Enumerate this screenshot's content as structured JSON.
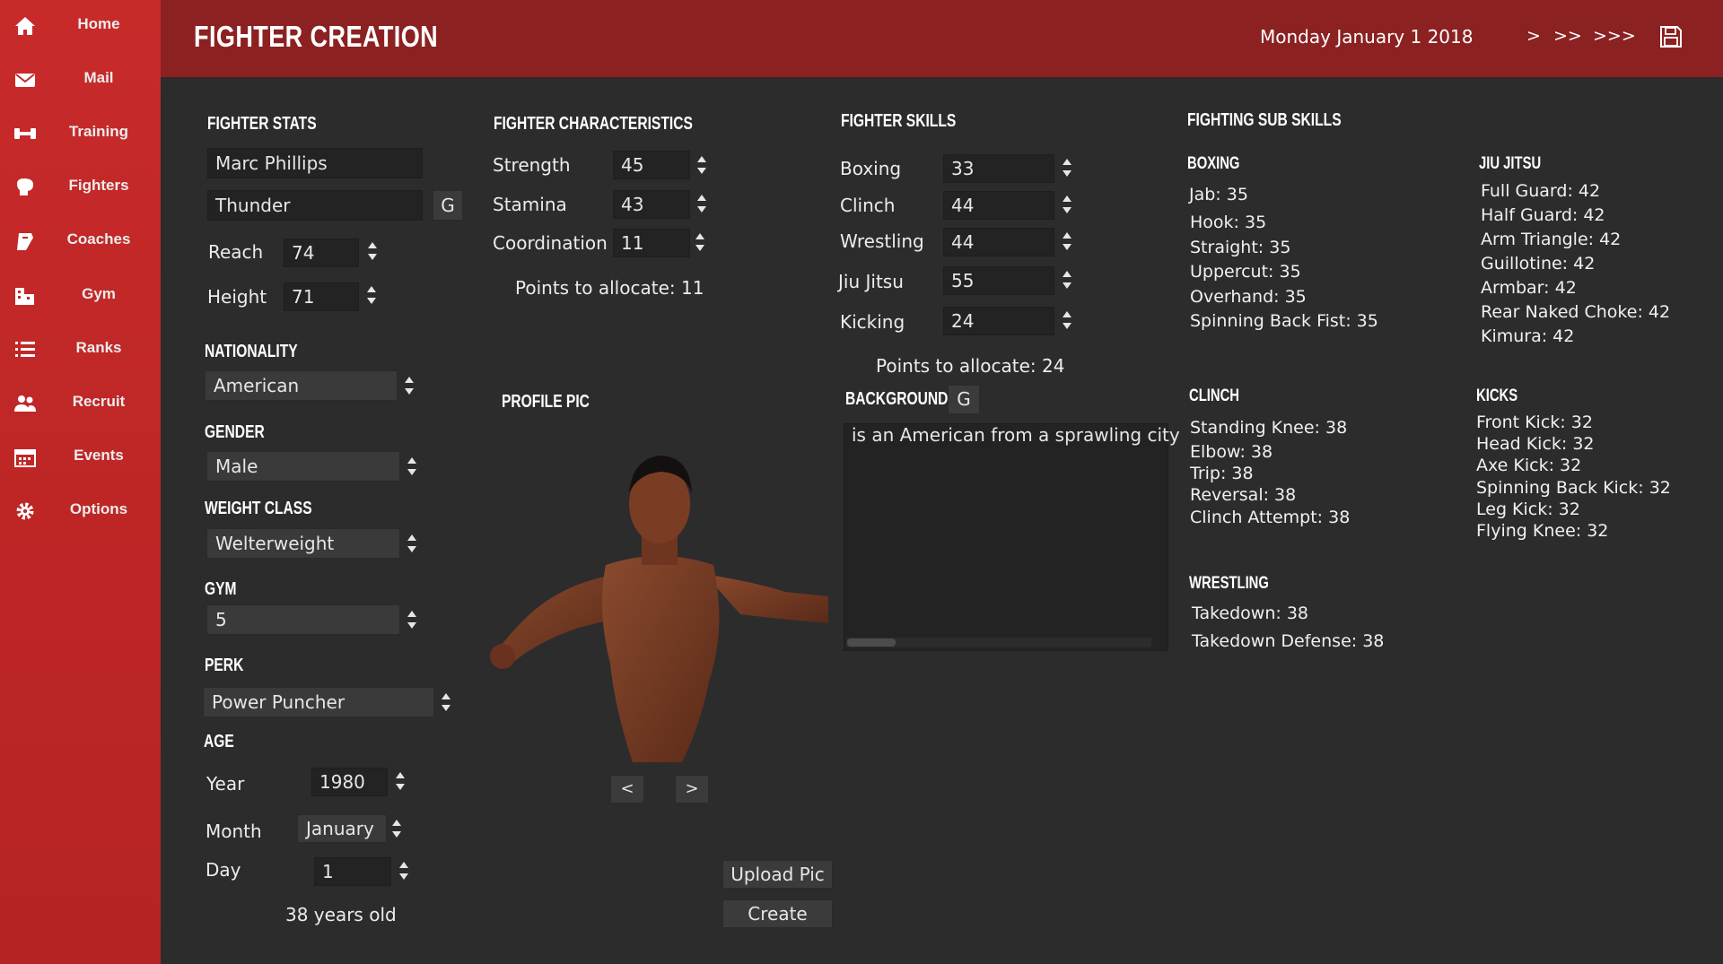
{
  "nav": [
    {
      "label": "Home",
      "icon": "home-icon"
    },
    {
      "label": "Mail",
      "icon": "mail-icon"
    },
    {
      "label": "Training",
      "icon": "dumbbell-icon"
    },
    {
      "label": "Fighters",
      "icon": "glove-icon"
    },
    {
      "label": "Coaches",
      "icon": "clipboard-icon"
    },
    {
      "label": "Gym",
      "icon": "building-icon"
    },
    {
      "label": "Ranks",
      "icon": "list-icon"
    },
    {
      "label": "Recruit",
      "icon": "users-icon"
    },
    {
      "label": "Events",
      "icon": "calendar-icon"
    },
    {
      "label": "Options",
      "icon": "gear-icon"
    }
  ],
  "header": {
    "title": "FIGHTER CREATION",
    "date": "Monday January 1 2018",
    "advance_1": ">",
    "advance_2": ">>",
    "advance_3": ">>>"
  },
  "stats": {
    "heading": "FIGHTER STATS",
    "name": "Marc Phillips",
    "nickname": "Thunder",
    "generate_label": "G",
    "reach_label": "Reach",
    "reach": "74",
    "height_label": "Height",
    "height": "71"
  },
  "nationality": {
    "heading": "NATIONALITY",
    "value": "American"
  },
  "gender": {
    "heading": "GENDER",
    "value": "Male"
  },
  "weight_class": {
    "heading": "WEIGHT CLASS",
    "value": "Welterweight"
  },
  "gym": {
    "heading": "GYM",
    "value": "5"
  },
  "perk": {
    "heading": "PERK",
    "value": "Power Puncher"
  },
  "age": {
    "heading": "AGE",
    "year_label": "Year",
    "year": "1980",
    "month_label": "Month",
    "month": "January",
    "day_label": "Day",
    "day": "1",
    "summary": "38 years old"
  },
  "characteristics": {
    "heading": "FIGHTER CHARACTERISTICS",
    "items": [
      {
        "label": "Strength",
        "value": "45"
      },
      {
        "label": "Stamina",
        "value": "43"
      },
      {
        "label": "Coordination",
        "value": "11"
      }
    ],
    "points": "Points to allocate: 11"
  },
  "profile": {
    "heading": "PROFILE PIC",
    "prev": "<",
    "next": ">",
    "upload": "Upload Pic",
    "create": "Create"
  },
  "skills": {
    "heading": "FIGHTER SKILLS",
    "items": [
      {
        "label": "Boxing",
        "value": "33"
      },
      {
        "label": "Clinch",
        "value": "44"
      },
      {
        "label": "Wrestling",
        "value": "44"
      },
      {
        "label": "Jiu Jitsu",
        "value": "55"
      },
      {
        "label": "Kicking",
        "value": "24"
      }
    ],
    "points": "Points to allocate: 24"
  },
  "background": {
    "heading": "BACKGROUND",
    "generate_label": "G",
    "text": "is an American from a sprawling city"
  },
  "subskills": {
    "heading": "FIGHTING SUB SKILLS",
    "boxing": {
      "heading": "BOXING",
      "items": [
        "Jab: 35",
        "Hook: 35",
        "Straight: 35",
        "Uppercut: 35",
        "Overhand: 35",
        "Spinning Back Fist: 35"
      ]
    },
    "jiujitsu": {
      "heading": "JIU JITSU",
      "items": [
        "Full Guard: 42",
        "Half Guard: 42",
        "Arm Triangle: 42",
        "Guillotine: 42",
        "Armbar: 42",
        "Rear Naked Choke: 42",
        "Kimura: 42"
      ]
    },
    "clinch": {
      "heading": "CLINCH",
      "items": [
        "Standing Knee: 38",
        "Elbow: 38",
        "Trip: 38",
        "Reversal: 38",
        "Clinch Attempt: 38"
      ]
    },
    "kicks": {
      "heading": "KICKS",
      "items": [
        "Front Kick: 32",
        "Head Kick: 32",
        "Axe Kick: 32",
        "Spinning Back Kick: 32",
        "Leg Kick: 32",
        "Flying Knee: 32"
      ]
    },
    "wrestling": {
      "heading": "WRESTLING",
      "items": [
        "Takedown: 38",
        "Takedown Defense: 38"
      ]
    }
  }
}
